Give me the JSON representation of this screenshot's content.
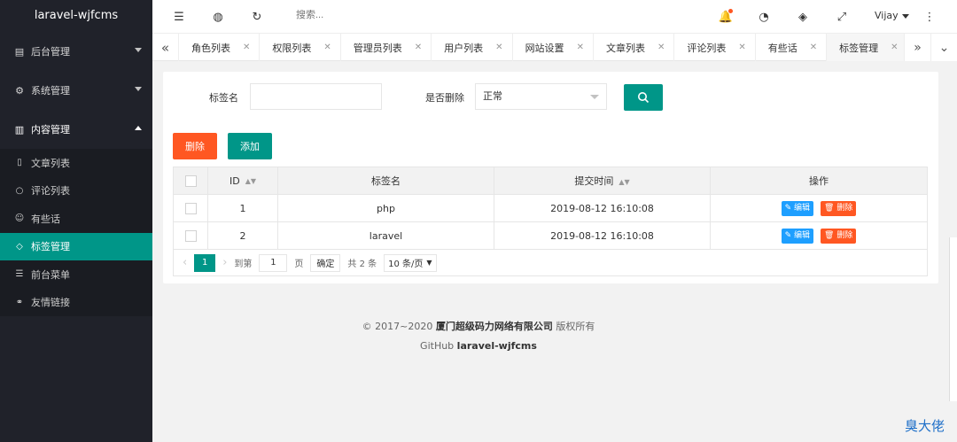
{
  "app": {
    "title": "laravel-wjfcms"
  },
  "sidebar": {
    "menus": [
      {
        "label": "后台管理",
        "icon": "dashboard-icon"
      },
      {
        "label": "系统管理",
        "icon": "gear-icon"
      },
      {
        "label": "内容管理",
        "icon": "book-icon"
      }
    ],
    "sub_items": [
      {
        "label": "文章列表",
        "icon": "file-icon"
      },
      {
        "label": "评论列表",
        "icon": "comment-icon"
      },
      {
        "label": "有些话",
        "icon": "smile-icon"
      },
      {
        "label": "标签管理",
        "icon": "tag-icon"
      },
      {
        "label": "前台菜单",
        "icon": "menu-icon"
      },
      {
        "label": "友情链接",
        "icon": "link-icon"
      }
    ]
  },
  "header": {
    "search_placeholder": "搜索...",
    "user": "Vijay"
  },
  "tabs": [
    "角色列表",
    "权限列表",
    "管理员列表",
    "用户列表",
    "网站设置",
    "文章列表",
    "评论列表",
    "有些话",
    "标签管理"
  ],
  "filter": {
    "tag_label": "标签名",
    "tag_value": "",
    "deleted_label": "是否删除",
    "deleted_value": "正常"
  },
  "actions": {
    "delete": "删除",
    "add": "添加"
  },
  "table": {
    "headers": [
      "ID",
      "标签名",
      "提交时间",
      "操作"
    ],
    "rows": [
      {
        "id": "1",
        "name": "php",
        "time": "2019-08-12 16:10:08"
      },
      {
        "id": "2",
        "name": "laravel",
        "time": "2019-08-12 16:10:08"
      }
    ],
    "edit": "编辑",
    "del": "删除"
  },
  "pager": {
    "current": "1",
    "goto_label": "到第",
    "goto_value": "1",
    "page_unit": "页",
    "confirm": "确定",
    "total": "共 2 条",
    "per_page": "10 条/页"
  },
  "footer": {
    "copyright": "© 2017~2020",
    "company": "厦门超级码力网络有限公司",
    "rights": "版权所有",
    "github_label": "GitHub",
    "github_name": "laravel-wjfcms"
  },
  "watermark": "臭大佬",
  "colors": {
    "accent": "#009688",
    "danger": "#ff5722",
    "info": "#1e9fff",
    "sidebar": "#20222a"
  }
}
